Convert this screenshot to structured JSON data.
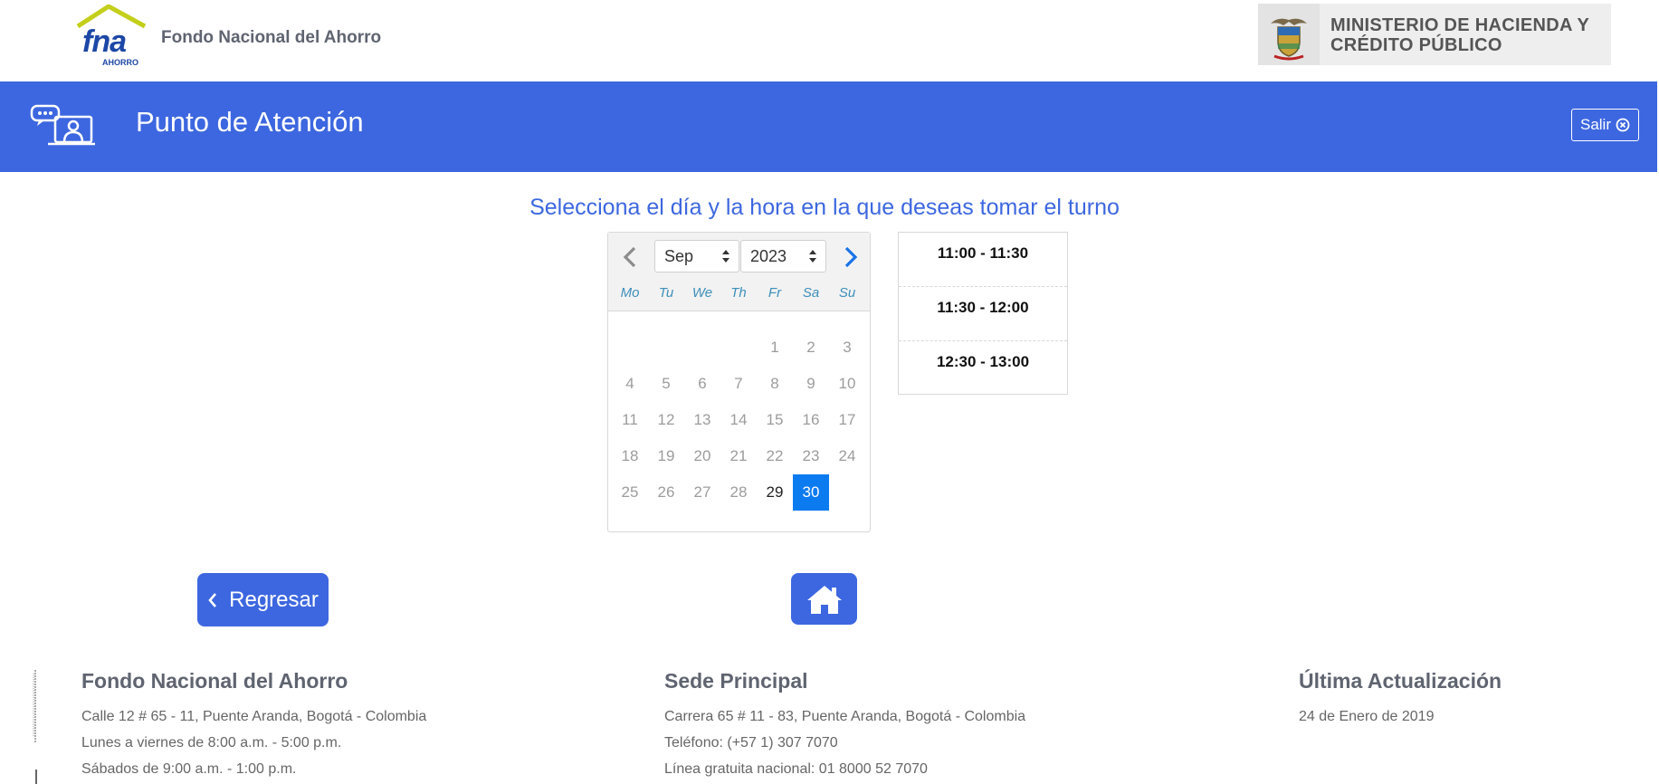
{
  "header": {
    "logo_text": "fna",
    "logo_sub": "AHORRO",
    "brand_name": "Fondo Nacional del Ahorro",
    "ministry_line1": "MINISTERIO DE HACIENDA Y",
    "ministry_line2": "CRÉDITO PÚBLICO"
  },
  "banner": {
    "title": "Punto de Atención",
    "exit_label": "Salir",
    "color": "#3d67e0"
  },
  "scheduler": {
    "heading": "Selecciona el día y la hora en la que deseas tomar el turno",
    "month": "Sep",
    "year": "2023",
    "weekdays": [
      "Mo",
      "Tu",
      "We",
      "Th",
      "Fr",
      "Sa",
      "Su"
    ],
    "days": [
      "1",
      "2",
      "3",
      "4",
      "5",
      "6",
      "7",
      "8",
      "9",
      "10",
      "11",
      "12",
      "13",
      "14",
      "15",
      "16",
      "17",
      "18",
      "19",
      "20",
      "21",
      "22",
      "23",
      "24",
      "25",
      "26",
      "27",
      "28",
      "29",
      "30"
    ],
    "available_days": [
      "29",
      "30"
    ],
    "selected_day": "30",
    "selected_color": "#0d7bf0",
    "time_slots": [
      "11:00 - 11:30",
      "11:30 - 12:00",
      "12:30 - 13:00"
    ]
  },
  "actions": {
    "back_label": "Regresar",
    "home_icon": "home-icon"
  },
  "footer": {
    "col1": {
      "title": "Fondo Nacional del Ahorro",
      "lines": [
        "Calle 12 # 65 - 11, Puente Aranda, Bogotá - Colombia",
        "Lunes a viernes de 8:00 a.m. - 5:00 p.m.",
        "Sábados de 9:00 a.m. - 1:00 p.m."
      ]
    },
    "col2": {
      "title": "Sede Principal",
      "lines": [
        "Carrera 65 # 11 - 83, Puente Aranda, Bogotá - Colombia",
        "Teléfono: (+57 1) 307 7070",
        "Línea gratuita nacional: 01 8000 52 7070"
      ]
    },
    "col3": {
      "title": "Última Actualización",
      "lines": [
        "24 de Enero de 2019"
      ]
    }
  }
}
